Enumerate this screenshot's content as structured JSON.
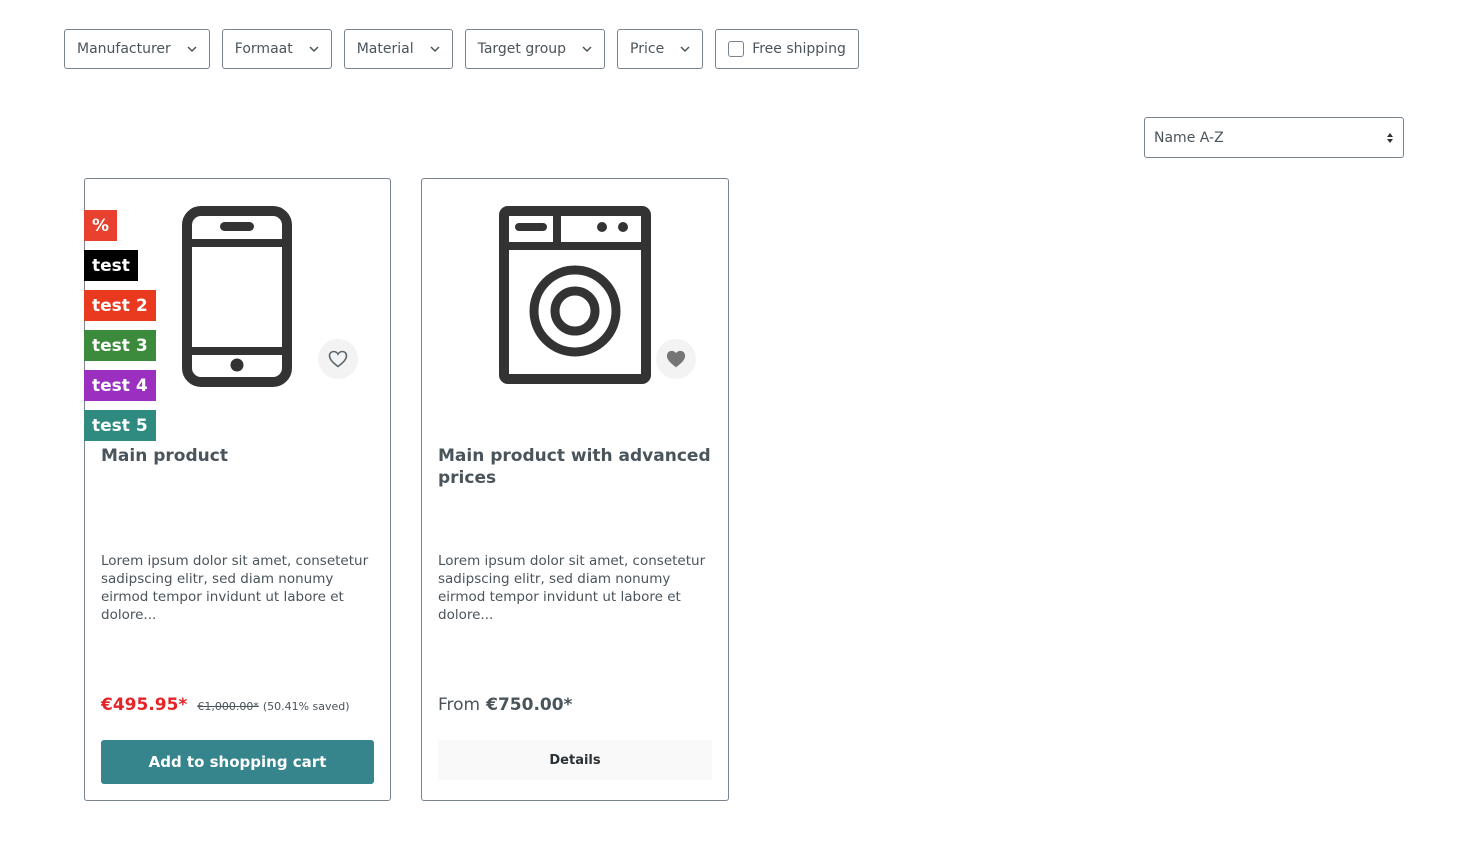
{
  "filters": [
    {
      "label": "Manufacturer",
      "icon": "chevron-down-icon"
    },
    {
      "label": "Formaat",
      "icon": "chevron-down-icon"
    },
    {
      "label": "Material",
      "icon": "chevron-down-icon"
    },
    {
      "label": "Target group",
      "icon": "chevron-down-icon"
    },
    {
      "label": "Price",
      "icon": "chevron-down-icon"
    }
  ],
  "free_shipping": {
    "label": "Free shipping",
    "checked": false
  },
  "sorting": {
    "selected": "Name A-Z",
    "icon": "sort-arrows-icon"
  },
  "colors": {
    "border": "#798490",
    "text": "#4a545b",
    "sale_red": "#e52427",
    "primary": "#37858c",
    "badge_percent": "#e8412f",
    "badge_test": "#000000",
    "badge_test2": "#e9391f",
    "badge_test3": "#3c8a3c",
    "badge_test4": "#9a2fc0",
    "badge_test5": "#2f8a80"
  },
  "products": [
    {
      "badges": [
        {
          "label": "%",
          "color": "#e8412f"
        },
        {
          "label": "test",
          "color": "#000000"
        },
        {
          "label": "test 2",
          "color": "#e9391f"
        },
        {
          "label": "test 3",
          "color": "#3c8a3c"
        },
        {
          "label": "test 4",
          "color": "#9a2fc0"
        },
        {
          "label": "test 5",
          "color": "#2f8a80"
        }
      ],
      "image_icon": "smartphone-icon",
      "wishlist_icon": "heart-outline-icon",
      "title": "Main product",
      "description": "Lorem ipsum dolor sit amet, consetetur sadipscing elitr, sed diam nonumy eirmod tempor invidunt ut labore et dolore...",
      "price": "€495.95*",
      "list_price": "€1,000.00*",
      "saved": "(50.41% saved)",
      "action": "Add to shopping cart"
    },
    {
      "badges": [],
      "image_icon": "washing-machine-icon",
      "wishlist_icon": "heart-filled-icon",
      "title": "Main product with advanced prices",
      "description": "Lorem ipsum dolor sit amet, consetetur sadipscing elitr, sed diam nonumy eirmod tempor invidunt ut labore et dolore...",
      "price_prefix": "From",
      "price": "€750.00*",
      "action": "Details"
    }
  ]
}
